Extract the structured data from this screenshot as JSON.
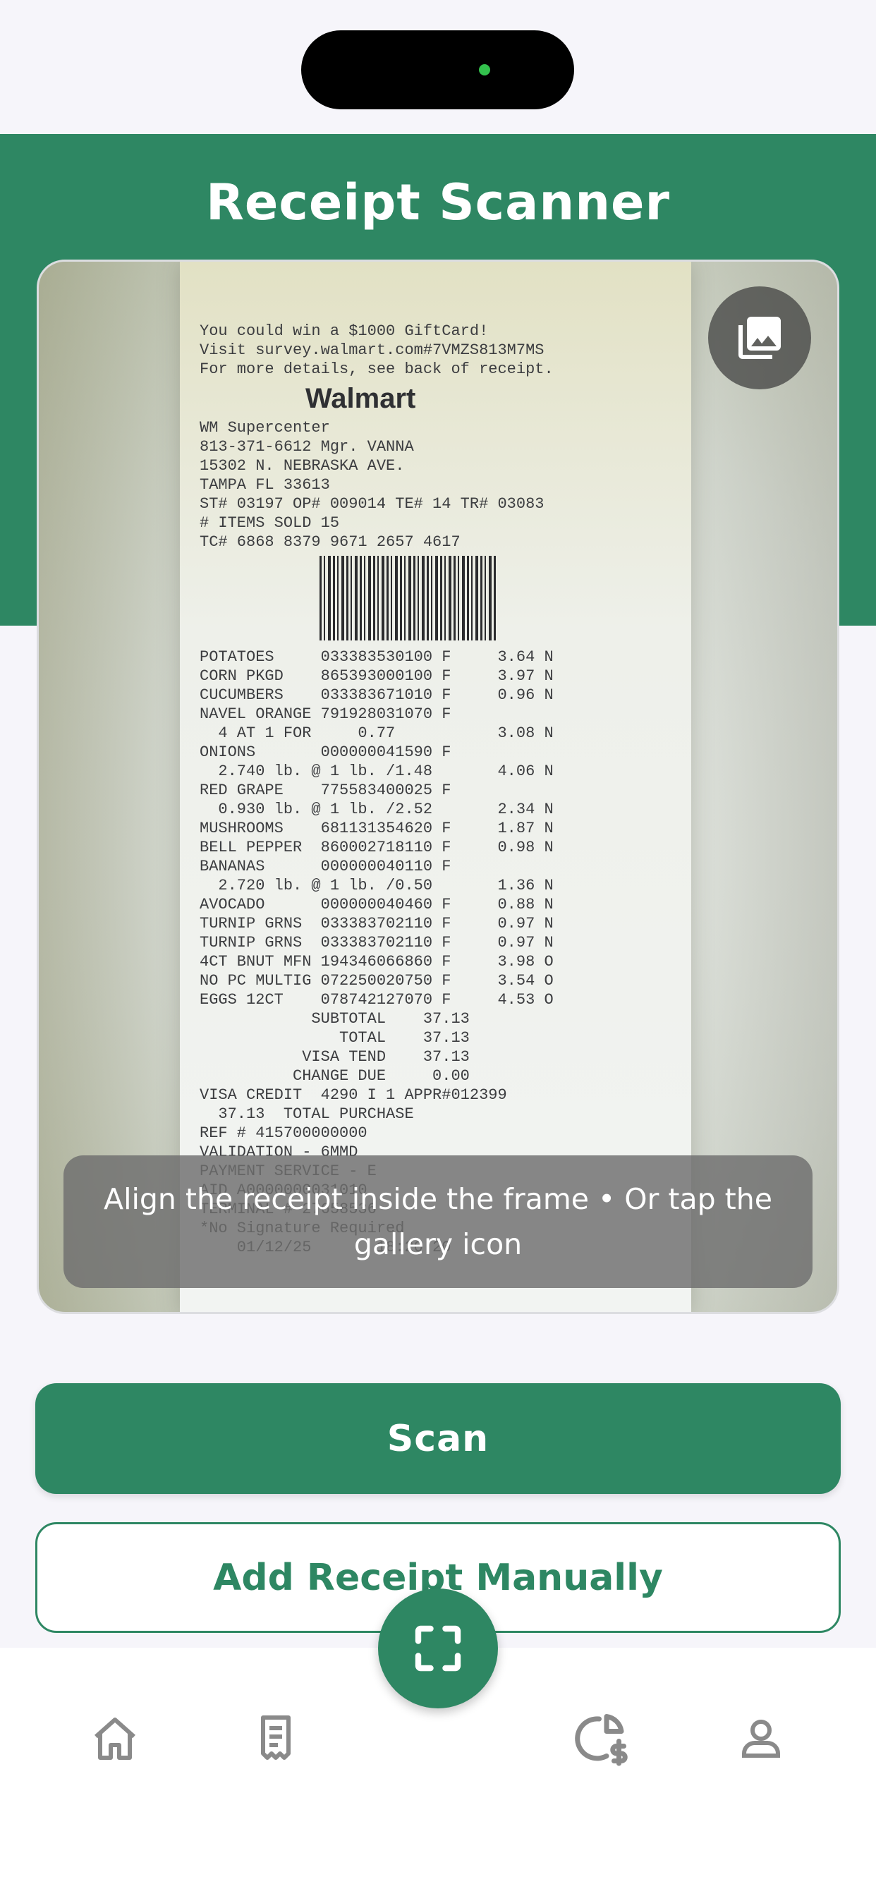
{
  "app": {
    "title": "Receipt Scanner"
  },
  "colors": {
    "primary": "#2e8763",
    "background": "#f6f5fa",
    "nav_icon": "#8a8a8a"
  },
  "camera": {
    "hint": "Align the receipt inside the frame • Or tap the gallery icon",
    "gallery_icon": "image-gallery-icon",
    "receipt_lines": [
      "You could win a $1000 GiftCard!",
      "Visit survey.walmart.com#7VMZS813M7MS",
      "For more details, see back of receipt.",
      "Walmart",
      "WM Supercenter",
      "813-371-6612 Mgr. VANNA",
      "15302 N. NEBRASKA AVE.",
      "TAMPA FL 33613",
      "ST# 03197 OP# 009014 TE# 14 TR# 03083",
      "# ITEMS SOLD 15",
      "TC# 6868 8379 9671 2657 4617",
      "POTATOES     033383530100 F     3.64 N",
      "CORN PKGD    865393000100 F     3.97 N",
      "CUCUMBERS    033383671010 F     0.96 N",
      "NAVEL ORANGE 791928031070 F",
      "  4 AT 1 FOR     0.77           3.08 N",
      "ONIONS       000000041590 F",
      "  2.740 lb. @ 1 lb. /1.48       4.06 N",
      "RED GRAPE    775583400025 F",
      "  0.930 lb. @ 1 lb. /2.52       2.34 N",
      "MUSHROOMS    681131354620 F     1.87 N",
      "BELL PEPPER  860002718110 F     0.98 N",
      "BANANAS      000000040110 F",
      "  2.720 lb. @ 1 lb. /0.50       1.36 N",
      "AVOCADO      000000040460 F     0.88 N",
      "TURNIP GRNS  033383702110 F     0.97 N",
      "TURNIP GRNS  033383702110 F     0.97 N",
      "4CT BNUT MFN 194346066860 F     3.98 O",
      "NO PC MULTIG 072250020750 F     3.54 O",
      "EGGS 12CT    078742127070 F     4.53 O",
      "            SUBTOTAL    37.13",
      "               TOTAL    37.13",
      "           VISA TEND    37.13",
      "          CHANGE DUE     0.00",
      "VISA CREDIT  4290 I 1 APPR#012399",
      "  37.13  TOTAL PURCHASE",
      "REF # 415700000000",
      "VALIDATION - 6MMD",
      "PAYMENT SERVICE - E",
      "AID A0000000031010",
      "TERMINAL # 27658536",
      "*No Signature Required",
      "    01/12/25       18:20:20"
    ]
  },
  "actions": {
    "scan_label": "Scan",
    "manual_label": "Add Receipt Manually"
  },
  "nav": {
    "items": [
      {
        "name": "home-icon"
      },
      {
        "name": "receipts-icon"
      },
      {
        "name": "scan-icon"
      },
      {
        "name": "budget-icon"
      },
      {
        "name": "profile-icon"
      }
    ]
  }
}
